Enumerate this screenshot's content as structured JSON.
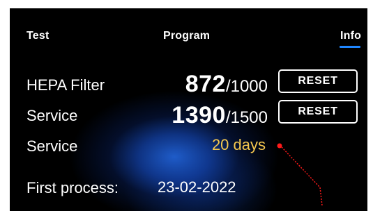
{
  "tabs": {
    "test": "Test",
    "program": "Program",
    "info": "Info"
  },
  "hepa": {
    "label": "HEPA Filter",
    "current": "872",
    "separator_total": "/1000",
    "reset": "RESET"
  },
  "service_counter": {
    "label": "Service",
    "current": "1390",
    "separator_total": "/1500",
    "reset": "RESET"
  },
  "service_days": {
    "label": "Service",
    "value": "20 days"
  },
  "first_process": {
    "label": "First process:",
    "value": "23-02-2022"
  },
  "colors": {
    "screen_bg": "#000000",
    "text": "#ffffff",
    "accent_tab": "#1f86ff",
    "days_yellow": "#f6c84f",
    "annotation_red": "#ff1a1a",
    "glow_blue": "#2060d2"
  }
}
